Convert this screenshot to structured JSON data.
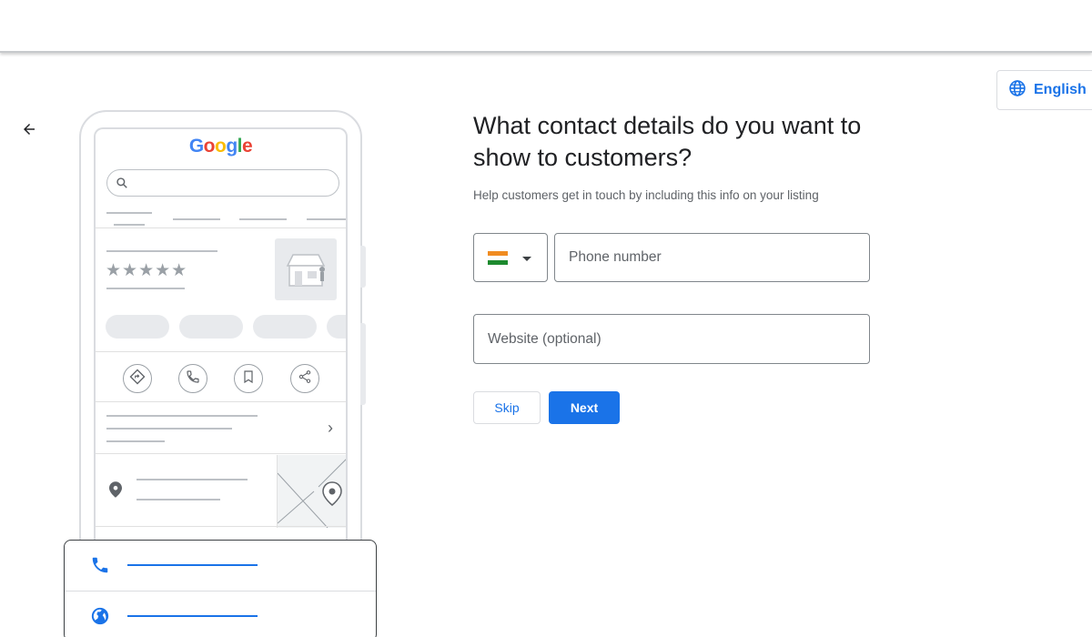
{
  "header": {},
  "language": {
    "label": "English",
    "icon": "globe-icon"
  },
  "navigation": {
    "back_icon": "arrow-back-icon"
  },
  "illustration": {
    "logo_text": "Google",
    "rating_stars": "★★★★★",
    "actions": [
      "directions-icon",
      "phone-icon",
      "bookmark-icon",
      "share-icon"
    ],
    "contact_card": {
      "rows": [
        "phone-icon",
        "globe-icon"
      ],
      "accent": "#1a73e8"
    }
  },
  "form": {
    "title": "What contact details do you want to show to customers?",
    "subtitle": "Help customers get in touch by including this info on your listing",
    "country": {
      "selected": "India",
      "icon": "india-flag-icon"
    },
    "phone_placeholder": "Phone number",
    "website_placeholder": "Website (optional)",
    "skip_label": "Skip",
    "next_label": "Next"
  },
  "colors": {
    "primary": "#1a73e8",
    "border": "#80868b",
    "muted": "#5f6368"
  }
}
